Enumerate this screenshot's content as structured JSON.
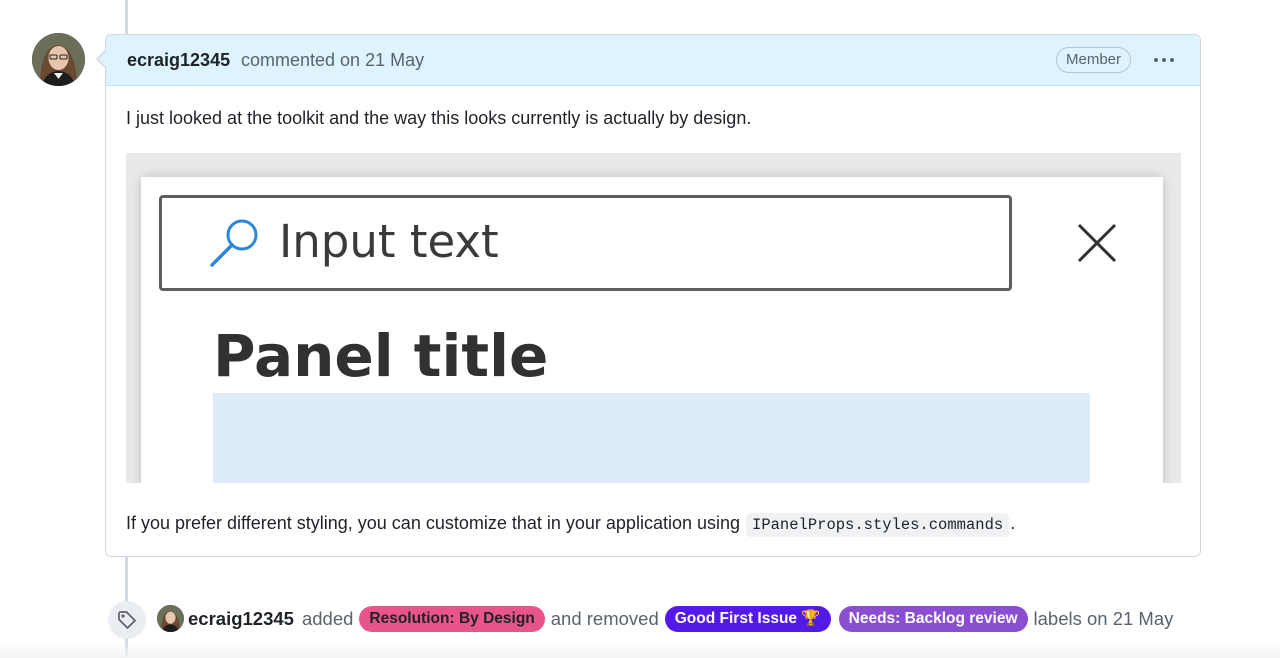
{
  "comment": {
    "author": "ecraig12345",
    "meta": "commented on 21 May",
    "role_badge": "Member",
    "paragraph1": "I just looked at the toolkit and the way this looks currently is actually by design.",
    "paragraph2_before": "If you prefer different styling, you can customize that in your application using",
    "paragraph2_code": "IPanelProps.styles.commands",
    "paragraph2_after": "."
  },
  "embedded_screenshot": {
    "search_text": "Input text",
    "panel_title": "Panel title"
  },
  "event": {
    "actor": "ecraig12345",
    "added_text": "added",
    "removed_text": "and removed",
    "suffix_text": "labels on 21 May",
    "added_labels": [
      {
        "text": "Resolution: By Design",
        "bg": "#e8558a",
        "fg": "#1f2328"
      }
    ],
    "removed_labels": [
      {
        "text": "Good First Issue 🏆",
        "bg": "#5319e7",
        "fg": "#ffffff"
      },
      {
        "text": "Needs: Backlog review",
        "bg": "#8a4fd1",
        "fg": "#ffffff"
      }
    ]
  },
  "icons": {
    "more_options": "kebab-horizontal-icon",
    "labels_event": "tag-icon",
    "search": "search-icon",
    "close": "close-icon"
  }
}
